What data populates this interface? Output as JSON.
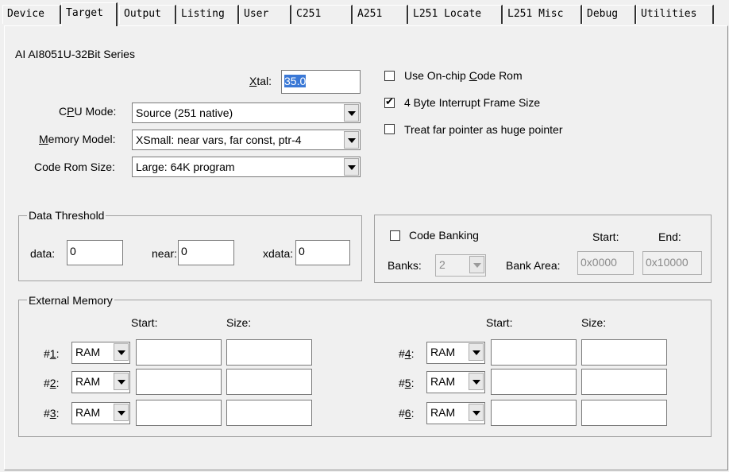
{
  "tabs": [
    {
      "label": "Device",
      "active": false
    },
    {
      "label": "Target",
      "active": true
    },
    {
      "label": "Output",
      "active": false
    },
    {
      "label": "Listing",
      "active": false
    },
    {
      "label": "User",
      "active": false
    },
    {
      "label": "C251",
      "active": false
    },
    {
      "label": "A251",
      "active": false
    },
    {
      "label": "L251 Locate",
      "active": false
    },
    {
      "label": "L251 Misc",
      "active": false
    },
    {
      "label": "Debug",
      "active": false
    },
    {
      "label": "Utilities",
      "active": false
    }
  ],
  "device_name": "AI AI8051U-32Bit Series",
  "xtal": {
    "label_pre": "",
    "label_u": "X",
    "label_post": "tal:",
    "value": "35.0"
  },
  "cpu_mode": {
    "label_pre": "C",
    "label_u": "P",
    "label_post": "U Mode:",
    "value": "Source (251 native)"
  },
  "memory_model": {
    "label_pre": "",
    "label_u": "M",
    "label_post": "emory Model:",
    "value": "XSmall: near vars, far const, ptr-4"
  },
  "code_rom_size": {
    "label": "Code Rom Size:",
    "value": "Large: 64K program"
  },
  "options": [
    {
      "pre": "Use On-chip ",
      "u": "C",
      "post": "ode Rom",
      "checked": false
    },
    {
      "pre": "4 Byte Interrupt Frame Size",
      "u": "",
      "post": "",
      "checked": true
    },
    {
      "pre": "Treat far pointer as huge pointer",
      "u": "",
      "post": "",
      "checked": false
    }
  ],
  "data_threshold": {
    "title": "Data Threshold",
    "data_label": "data:",
    "data_value": "0",
    "near_label": "near:",
    "near_value": "0",
    "xdata_label": "xdata:",
    "xdata_value": "0"
  },
  "code_banking": {
    "label": "Code Banking",
    "checked": false,
    "start_header": "Start:",
    "end_header": "End:",
    "banks_label": "Banks:",
    "banks_value": "2",
    "bank_area_label": "Bank Area:",
    "bank_area_start": "0x0000",
    "bank_area_end": "0x10000"
  },
  "external_memory": {
    "title": "External Memory",
    "start_header": "Start:",
    "size_header": "Size:",
    "rows": [
      {
        "label_pre": "#",
        "label_u": "1",
        "label_post": ":",
        "type": "RAM",
        "start": "",
        "size": ""
      },
      {
        "label_pre": "#",
        "label_u": "2",
        "label_post": ":",
        "type": "RAM",
        "start": "",
        "size": ""
      },
      {
        "label_pre": "#",
        "label_u": "3",
        "label_post": ":",
        "type": "RAM",
        "start": "",
        "size": ""
      },
      {
        "label_pre": "#",
        "label_u": "4",
        "label_post": ":",
        "type": "RAM",
        "start": "",
        "size": ""
      },
      {
        "label_pre": "#",
        "label_u": "5",
        "label_post": ":",
        "type": "RAM",
        "start": "",
        "size": ""
      },
      {
        "label_pre": "#",
        "label_u": "6",
        "label_post": ":",
        "type": "RAM",
        "start": "",
        "size": ""
      }
    ]
  }
}
